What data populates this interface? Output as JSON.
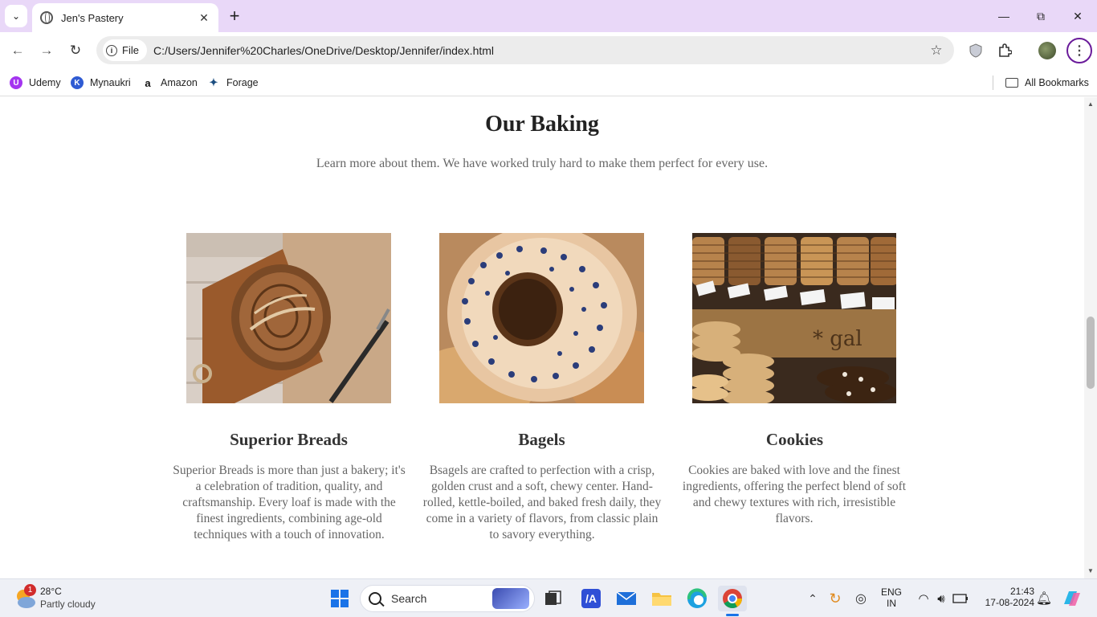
{
  "browser": {
    "tab_title": "Jen's Pastery",
    "site_chip": "File",
    "url": "C:/Users/Jennifer%20Charles/OneDrive/Desktop/Jennifer/index.html",
    "bookmarks": [
      "Udemy",
      "Mynaukri",
      "Amazon",
      "Forage"
    ],
    "all_bookmarks": "All Bookmarks"
  },
  "page": {
    "section_title": "Our Baking",
    "section_subtitle": "Learn more about them. We have worked truly hard to make them perfect for every use.",
    "cards": [
      {
        "title": "Superior Breads",
        "text": "Superior Breads is more than just a bakery; it's a celebration of tradition, quality, and craftsmanship. Every loaf is made with the finest ingredients, combining age-old techniques with a touch of innovation."
      },
      {
        "title": "Bagels",
        "text": "Bsagels are crafted to perfection with a crisp, golden crust and a soft, chewy center. Hand-rolled, kettle-boiled, and baked fresh daily, they come in a variety of flavors, from classic plain to savory everything."
      },
      {
        "title": "Cookies",
        "text": "Cookies are baked with love and the finest ingredients, offering the perfect blend of soft and chewy textures with rich, irresistible flavors."
      }
    ]
  },
  "taskbar": {
    "weather_temp": "28°C",
    "weather_desc": "Partly cloudy",
    "weather_badge": "1",
    "search_label": "Search",
    "lang_top": "ENG",
    "lang_bottom": "IN",
    "time": "21:43",
    "date": "17-08-2024"
  },
  "colors": {
    "tabbar_bg": "#e9d8f8",
    "accent": "#6a1b9a"
  }
}
